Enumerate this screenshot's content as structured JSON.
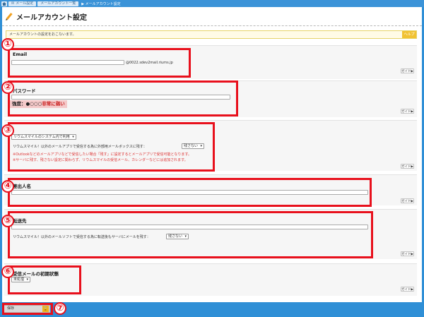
{
  "breadcrumb": {
    "items": [
      "メール設定",
      "メールアカウント一覧"
    ],
    "current": "メールアカウント設定"
  },
  "page": {
    "title": "メールアカウント設定"
  },
  "info": {
    "text": "メールアカウントの設定をおこないます。",
    "badge": "ヘルプ"
  },
  "email": {
    "label": "Email",
    "domain": "@0022.sdev2mail.riums.jp"
  },
  "password": {
    "label": "パスワード",
    "strength_label": "強度：",
    "strength_marks": "●○○○",
    "strength_text": "非常に弱い"
  },
  "receive": {
    "mode_value": "リウムスマイルのシステム内で利用",
    "keep_text": "リウムスマイル！以外のメールアプリで受信する為に外部用メールボックスに残す：",
    "keep_value": "残さない",
    "note1": "※Outlookなどのメールアプリなどで受信したい場合「残す」に設定するとメールアプリで受信可能となります。",
    "note2": "※サーバに残す、残さない設定に関わらず、リウムスマイルの受信メール、カレンダーなどには追加されます。"
  },
  "sender_name": {
    "label": "差出人名"
  },
  "forward": {
    "label": "転送先",
    "keep_text": "リウムスマイル！以外のメールソフトで受信する為に転送後もサーバにメールを残す：",
    "keep_value": "残さない"
  },
  "initial_state": {
    "label": "受信メールの初期状態",
    "value": "未処理"
  },
  "guide_label": "ガイド▶",
  "footer": {
    "save_label": "保存"
  },
  "markers": [
    "①",
    "②",
    "③",
    "④",
    "⑤",
    "⑥",
    "⑦"
  ],
  "colors": {
    "highlight": "#e8101c",
    "footer": "#2f8fd6",
    "note": "#dd3333"
  }
}
